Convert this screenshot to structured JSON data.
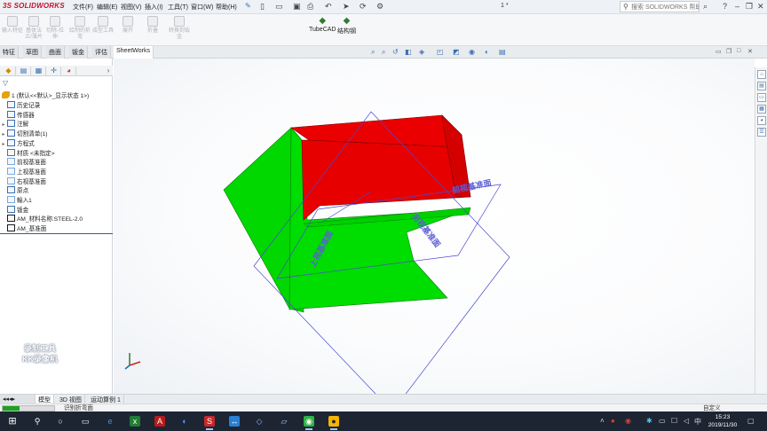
{
  "app": {
    "logo_ds": "3S",
    "logo_name": "SOLIDWORKS",
    "doc_title": "1 *"
  },
  "menu": [
    "文件(F)",
    "编辑(E)",
    "视图(V)",
    "插入(I)",
    "工具(T)",
    "窗口(W)",
    "帮助(H)"
  ],
  "search": {
    "placeholder": "搜索 SOLIDWORKS 帮助"
  },
  "ribbon": {
    "tools": [
      "输入特征",
      "基体法兰/薄片",
      "切除-拉伸",
      "绘制的折弯",
      "成型工具",
      "展开",
      "折叠",
      "转换到钣金"
    ],
    "big": [
      {
        "label": "TubeCAD",
        "icon": "tubecad-icon"
      },
      {
        "label": "结构钢",
        "icon": "structure-steel-icon"
      }
    ]
  },
  "command_tabs": [
    "特征",
    "草图",
    "曲面",
    "钣金",
    "评估",
    "SheetWorks"
  ],
  "active_command_tab": "SheetWorks",
  "tree": {
    "root": "1 (默认<<默认>_显示状态 1>)",
    "items": [
      {
        "label": "历史记录",
        "icon": "history-icon",
        "expand": ""
      },
      {
        "label": "传感器",
        "icon": "sensor-icon",
        "expand": ""
      },
      {
        "label": "注解",
        "icon": "annotation-icon",
        "expand": "▸"
      },
      {
        "label": "切割清单(1)",
        "icon": "cutlist-icon",
        "expand": "▸"
      },
      {
        "label": "方程式",
        "icon": "equation-icon",
        "expand": "▸"
      },
      {
        "label": "材质 <未指定>",
        "icon": "material-icon",
        "expand": ""
      },
      {
        "label": "前视基准面",
        "icon": "plane-icon",
        "expand": ""
      },
      {
        "label": "上视基准面",
        "icon": "plane-icon",
        "expand": ""
      },
      {
        "label": "右视基准面",
        "icon": "plane-icon",
        "expand": ""
      },
      {
        "label": "原点",
        "icon": "origin-icon",
        "expand": ""
      },
      {
        "label": "輸入1",
        "icon": "import-icon",
        "expand": ""
      },
      {
        "label": "钣金",
        "icon": "sheetmetal-icon",
        "expand": ""
      },
      {
        "label": "AM_材料名称:STEEL-2.0",
        "icon": "attribute-icon",
        "expand": ""
      },
      {
        "label": "AM_基准面",
        "icon": "attribute-icon",
        "expand": ""
      }
    ]
  },
  "watermark": {
    "line1": "录制工具",
    "line2": "KK录像机"
  },
  "viewport": {
    "plane_labels": [
      "上视基准面",
      "右视基准面",
      "前视基准面"
    ],
    "colors": {
      "red_face": "#e60000",
      "green_face": "#00dc00",
      "plane": "#4a4ad0"
    }
  },
  "bottom_tabs": [
    "模型",
    "3D 视图",
    "运动算例 1"
  ],
  "active_bottom_tab": "模型",
  "status": {
    "text": "识别折弯面",
    "right": "自定义",
    "progress": 0.33
  },
  "taskbar": {
    "time": "15:23",
    "date": "2019/11/30",
    "ime": "中"
  }
}
